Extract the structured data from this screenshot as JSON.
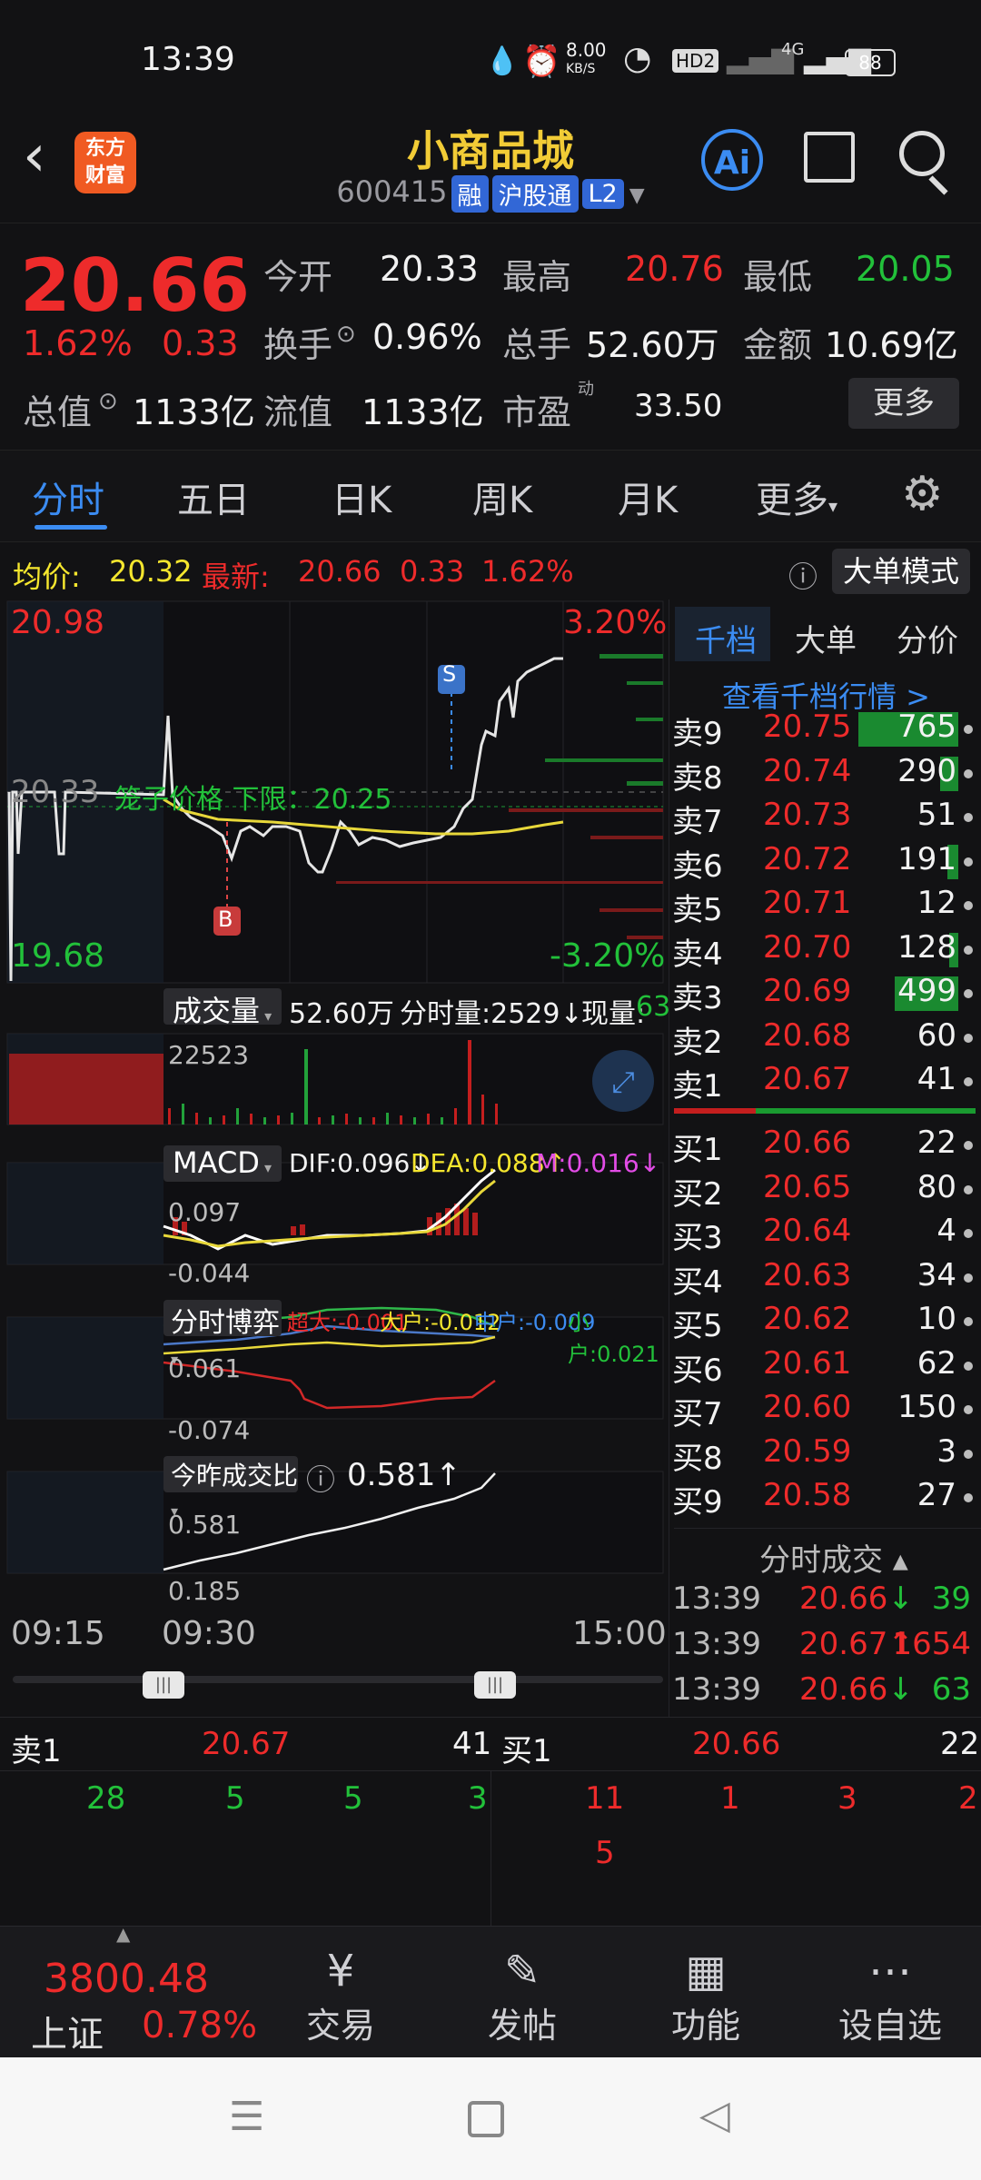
{
  "status_bar": {
    "time": "13:39",
    "net_speed_top": "8.00",
    "net_speed_bottom": "KB/S",
    "hd": "HD2",
    "signal": "4G",
    "battery": "88"
  },
  "header": {
    "logo_line1": "东方",
    "logo_line2": "财富",
    "title": "小商品城",
    "code": "600415",
    "badge1": "融",
    "badge2": "沪股通",
    "badge3": "L2",
    "ai": "Ai"
  },
  "quote": {
    "price": "20.66",
    "change_pct": "1.62%",
    "change": "0.33",
    "open_label": "今开",
    "open": "20.33",
    "high_label": "最高",
    "high": "20.76",
    "low_label": "最低",
    "low": "20.05",
    "turnover_label": "换手",
    "turnover": "0.96%",
    "volume_label": "总手",
    "volume": "52.60万",
    "amount_label": "金额",
    "amount": "10.69亿",
    "mktcap_label": "总值",
    "mktcap": "1133亿",
    "float_label": "流值",
    "float": "1133亿",
    "pe_label": "市盈",
    "pe_super": "动",
    "pe": "33.50",
    "more_button": "更多"
  },
  "tabs": [
    "分时",
    "五日",
    "日K",
    "周K",
    "月K",
    "更多"
  ],
  "summary": {
    "avg_label": "均价:",
    "avg": "20.32",
    "latest_label": "最新:",
    "latest": "20.66",
    "chg": "0.33",
    "pct": "1.62%",
    "mode_button": "大单模式"
  },
  "chart": {
    "top_price": "20.98",
    "bottom_price": "19.68",
    "top_pct": "3.20%",
    "bottom_pct": "-3.20%",
    "prev_close": "20.33",
    "cage_text": "笼子价格 下限：20.25",
    "marker_s": "S",
    "marker_b": "B",
    "vol_label": "成交量",
    "vol_total": "52.60万",
    "vol_minute": "分时量:2529",
    "vol_now_label": "现量:",
    "vol_now": "63",
    "vol_max": "22523",
    "macd_label": "MACD",
    "dif": "DIF:0.096",
    "dea": "DEA:0.088",
    "m": "M:0.016",
    "macd_top": "0.097",
    "macd_bot": "-0.044",
    "game_label": "分时博弈",
    "game_super": "超大:-0.001",
    "game_big": "大户:-0.012",
    "game_mid": "中户:-0.009",
    "game_small": "小户:0.021",
    "game_top": "0.061",
    "game_bot": "-0.074",
    "ratio_label": "今昨成交比",
    "ratio": "0.581",
    "ratio_top": "0.581",
    "ratio_bot": "0.185",
    "time_start": "09:15",
    "time_open": "09:30",
    "time_end": "15:00"
  },
  "chart_data": {
    "type": "line",
    "x_labels": [
      "09:15",
      "09:30",
      "15:00"
    ],
    "ylim": [
      19.68,
      20.98
    ],
    "ylim_pct": [
      "-3.20%",
      "3.20%"
    ],
    "prev_close": 20.33,
    "series": [],
    "volume_max": 22523,
    "macd": {
      "dif": 0.096,
      "dea": 0.088,
      "m": 0.016,
      "range": [
        -0.044,
        0.097
      ]
    },
    "game": {
      "super": -0.001,
      "big": -0.012,
      "mid": -0.009,
      "small": 0.021,
      "range": [
        -0.074,
        0.061
      ]
    },
    "ratio": {
      "value": 0.581,
      "range": [
        0.185,
        0.581
      ]
    }
  },
  "orderbook": {
    "tabs": [
      "千档",
      "大单",
      "分价"
    ],
    "link": "查看千档行情 >",
    "asks": [
      {
        "n": "卖9",
        "p": "20.75",
        "v": "765"
      },
      {
        "n": "卖8",
        "p": "20.74",
        "v": "290"
      },
      {
        "n": "卖7",
        "p": "20.73",
        "v": "51"
      },
      {
        "n": "卖6",
        "p": "20.72",
        "v": "191"
      },
      {
        "n": "卖5",
        "p": "20.71",
        "v": "12"
      },
      {
        "n": "卖4",
        "p": "20.70",
        "v": "128"
      },
      {
        "n": "卖3",
        "p": "20.69",
        "v": "499"
      },
      {
        "n": "卖2",
        "p": "20.68",
        "v": "60"
      },
      {
        "n": "卖1",
        "p": "20.67",
        "v": "41"
      }
    ],
    "bids": [
      {
        "n": "买1",
        "p": "20.66",
        "v": "22"
      },
      {
        "n": "买2",
        "p": "20.65",
        "v": "80"
      },
      {
        "n": "买3",
        "p": "20.64",
        "v": "4"
      },
      {
        "n": "买4",
        "p": "20.63",
        "v": "34"
      },
      {
        "n": "买5",
        "p": "20.62",
        "v": "10"
      },
      {
        "n": "买6",
        "p": "20.61",
        "v": "62"
      },
      {
        "n": "买7",
        "p": "20.60",
        "v": "150"
      },
      {
        "n": "买8",
        "p": "20.59",
        "v": "3"
      },
      {
        "n": "买9",
        "p": "20.58",
        "v": "27"
      }
    ],
    "trades_title": "分时成交",
    "trades": [
      {
        "t": "13:39",
        "p": "20.66",
        "dir": "↓",
        "v": "39"
      },
      {
        "t": "13:39",
        "p": "20.67",
        "dir": "↑",
        "v": "1654"
      },
      {
        "t": "13:39",
        "p": "20.66",
        "dir": "↓",
        "v": "63"
      }
    ]
  },
  "queue": {
    "sell_label": "卖1",
    "sell_price": "20.67",
    "sell_vol": "41",
    "buy_label": "买1",
    "buy_price": "20.66",
    "buy_vol": "22",
    "sell_orders": [
      "28",
      "5",
      "5",
      "3"
    ],
    "buy_orders": [
      "11",
      "1",
      "3",
      "2",
      "5"
    ]
  },
  "nav": {
    "index_value": "3800.48",
    "index_name": "上证",
    "index_pct": "0.78%",
    "trade": "交易",
    "post": "发帖",
    "func": "功能",
    "watch": "设自选"
  }
}
